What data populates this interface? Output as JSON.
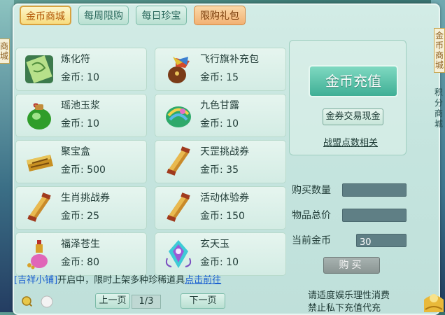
{
  "tabs": [
    {
      "label": "金币商城",
      "active": true
    },
    {
      "label": "每周限购",
      "active": false
    },
    {
      "label": "每日珍宝",
      "active": false
    },
    {
      "label": "限购礼包",
      "active": false
    }
  ],
  "side_tabs": {
    "left": "商城",
    "right": "金币商城",
    "right_text": "积分商城"
  },
  "currency_label": "金币:",
  "items": [
    {
      "name": "炼化符",
      "price": "10",
      "icon": "scroll-charm-icon"
    },
    {
      "name": "飞行旗补充包",
      "price": "15",
      "icon": "flag-pack-icon"
    },
    {
      "name": "瑶池玉浆",
      "price": "10",
      "icon": "green-jar-icon"
    },
    {
      "name": "九色甘露",
      "price": "10",
      "icon": "rainbow-gem-icon"
    },
    {
      "name": "聚宝盒",
      "price": "500",
      "icon": "treasure-box-icon"
    },
    {
      "name": "天罡挑战券",
      "price": "35",
      "icon": "scroll-ticket-icon"
    },
    {
      "name": "生肖挑战券",
      "price": "25",
      "icon": "scroll-ticket-icon"
    },
    {
      "name": "活动体验券",
      "price": "150",
      "icon": "scroll-ticket-icon"
    },
    {
      "name": "福泽苍生",
      "price": "80",
      "icon": "gourd-bottle-icon"
    },
    {
      "name": "玄天玉",
      "price": "10",
      "icon": "jade-pendant-icon"
    }
  ],
  "right_panel": {
    "recharge_label": "金币充值",
    "exchange_label": "金券交易现金",
    "alliance_link": "战盟点数相关",
    "buy_qty_label": "购买数量",
    "buy_qty_value": "",
    "total_label": "物品总价",
    "total_value": "",
    "current_gold_label": "当前金币",
    "current_gold_value": "30",
    "buy_label": "购买"
  },
  "notice": {
    "bracket_name": "[吉祥小铺]",
    "text": "开启中，限时上架多种珍稀道具",
    "link": "点击前往"
  },
  "pager": {
    "prev": "上一页",
    "page": "1/3",
    "next": "下一页"
  },
  "tips": {
    "line1": "请适度娱乐理性消费",
    "line2": "禁止私下充值代充"
  },
  "colors": {
    "panel_bg": "#c6e5df",
    "active_tab": "#f7dc7f",
    "recharge_button": "#3fae95",
    "link_blue": "#1a5fd0"
  }
}
